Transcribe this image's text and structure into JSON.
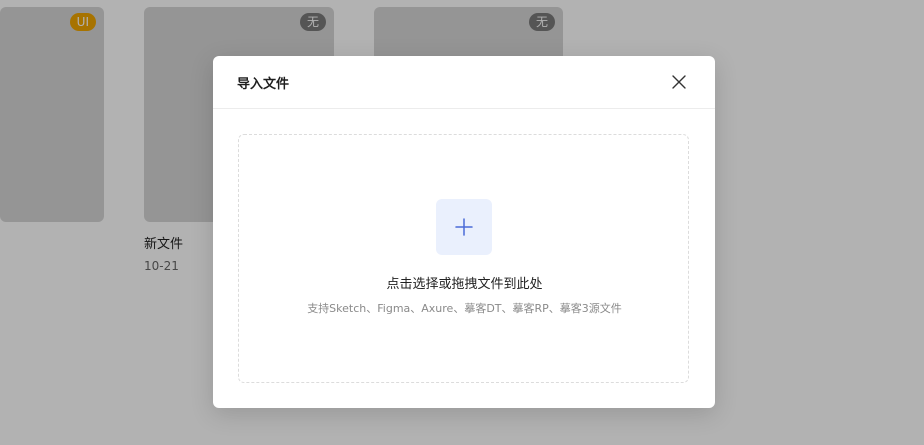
{
  "files": [
    {
      "badge": "UI",
      "name": "",
      "date": ""
    },
    {
      "badge": "无",
      "name": "新文件",
      "date": "10-21"
    },
    {
      "badge": "无",
      "name": "",
      "date": ""
    }
  ],
  "modal": {
    "title": "导入文件",
    "close_icon": "close-icon",
    "dropzone": {
      "plus_icon": "plus-icon",
      "title": "点击选择或拖拽文件到此处",
      "subtitle": "支持Sketch、Figma、Axure、摹客DT、摹客RP、摹客3源文件"
    }
  },
  "colors": {
    "overlay": "#000000",
    "accent": "#4b6bd8",
    "plus_box_bg": "#eaf0fd",
    "badge_ui": "#f0a500",
    "badge_default": "#7a7a7a"
  }
}
